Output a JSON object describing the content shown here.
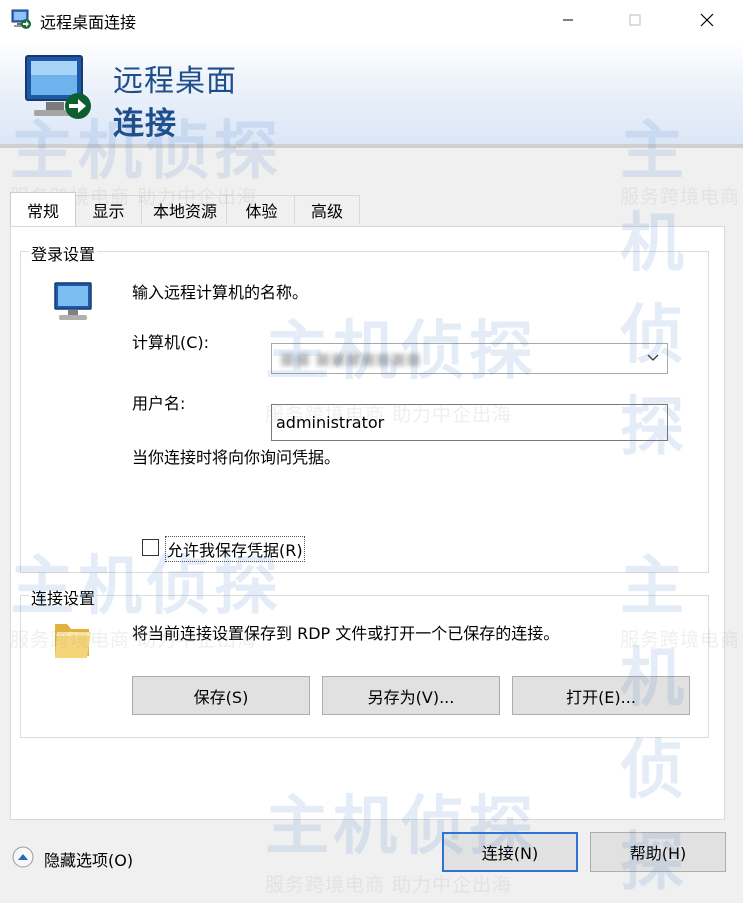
{
  "window": {
    "title": "远程桌面连接",
    "minimize_icon": "minimize-icon",
    "maximize_icon": "maximize-icon",
    "close_icon": "close-icon"
  },
  "banner": {
    "title_line1": "远程桌面",
    "title_line2": "连接"
  },
  "tabs": [
    {
      "label": "常规",
      "active": true
    },
    {
      "label": "显示",
      "active": false
    },
    {
      "label": "本地资源",
      "active": false
    },
    {
      "label": "体验",
      "active": false
    },
    {
      "label": "高级",
      "active": false
    }
  ],
  "login_settings": {
    "legend": "登录设置",
    "instruction": "输入远程计算机的名称。",
    "computer_label": "计算机(C):",
    "computer_value": "■■ ■■■■■■■",
    "username_label": "用户名:",
    "username_value": "administrator",
    "credential_note": "当你连接时将向你询问凭据。",
    "allow_save_label": "允许我保存凭据(R)",
    "allow_save_checked": false
  },
  "connection_settings": {
    "legend": "连接设置",
    "description": "将当前连接设置保存到 RDP 文件或打开一个已保存的连接。",
    "save_button": "保存(S)",
    "save_as_button": "另存为(V)...",
    "open_button": "打开(E)..."
  },
  "footer": {
    "hide_options_label": "隐藏选项(O)",
    "connect_button": "连接(N)",
    "help_button": "帮助(H)"
  },
  "watermark": {
    "brand": "主机侦探",
    "slogan": "服务跨境电商 助力中企出海"
  },
  "colors": {
    "banner_title": "#1e4f8b",
    "default_button_border": "#2b74d6",
    "window_background": "#f0f0f0"
  }
}
